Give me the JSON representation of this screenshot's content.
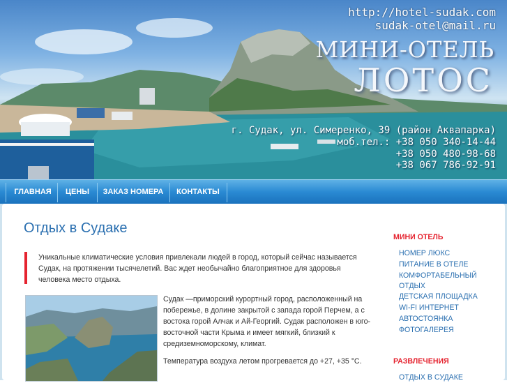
{
  "header": {
    "url": "http://hotel-sudak.com",
    "email": "sudak-otel@mail.ru",
    "brand_line1": "МИНИ-ОТЕЛЬ",
    "brand_line2": "ЛОТОС",
    "address": "г. Судак, ул. Симеренко, 39 (район Аквапарка)",
    "phones": [
      "моб.тел.: +38 050 340-14-44",
      "+38 050 480-98-68",
      "+38 067 786-92-91"
    ]
  },
  "nav": {
    "items": [
      "ГЛАВНАЯ",
      "ЦЕНЫ",
      "ЗАКАЗ НОМЕРА",
      "КОНТАКТЫ"
    ]
  },
  "main": {
    "title": "Отдых в Судаке",
    "intro": "Уникальные климатические условия привлекали людей в город, который сейчас называется Судак, на протяжении тысячелетий.  Вас ждет необычайно благоприятное для здоровья человека место отдыха.",
    "para1": "Судак  —приморский курортный город, расположенный на побережье, в долине закрытой с запада горой Перчем, а с востока горой Алчак и Ай-Георгий. Судак расположен в юго-восточной части Крыма и имеет  мягкий, близкий к средиземноморскому, климат.",
    "para2": "Температура воздуха летом прогревается до +27, +35 °С."
  },
  "sidebar": {
    "section1_title": "МИНИ ОТЕЛЬ",
    "section1_items": [
      "НОМЕР ЛЮКС",
      "ПИТАНИЕ В ОТЕЛЕ",
      "КОМФОРТАБЕЛЬНЫЙ ОТДЫХ",
      "ДЕТСКАЯ ПЛОЩАДКА",
      "WI-FI ИНТЕРНЕТ",
      "АВТОСТОЯНКА",
      "ФОТОГАЛЕРЕЯ"
    ],
    "section2_title": "РАЗВЛЕЧЕНИЯ",
    "section2_items": [
      "ОТДЫХ В СУДАКЕ"
    ]
  },
  "colors": {
    "accent_red": "#e5232f",
    "link_blue": "#2a6fb0",
    "nav_blue": "#2a8ad3"
  }
}
